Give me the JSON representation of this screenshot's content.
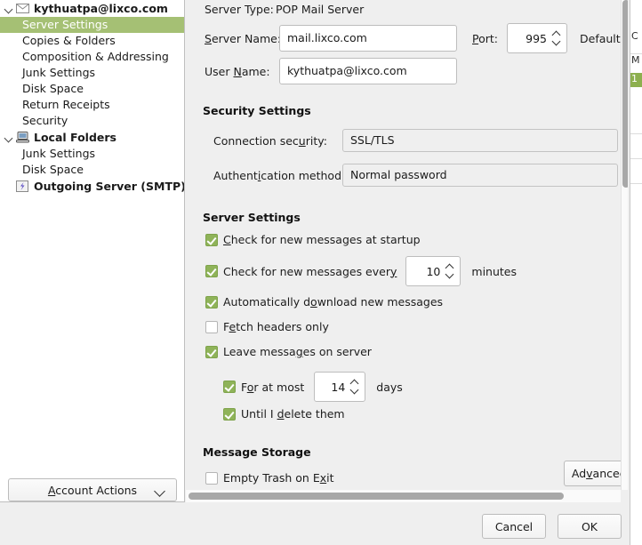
{
  "sidebar": {
    "account": {
      "label": "kythuatpa@lixco.com",
      "icon": "envelope-icon",
      "expanded": true,
      "items": [
        {
          "label": "Server Settings",
          "selected": true
        },
        {
          "label": "Copies & Folders",
          "selected": false
        },
        {
          "label": "Composition & Addressing",
          "selected": false
        },
        {
          "label": "Junk Settings",
          "selected": false
        },
        {
          "label": "Disk Space",
          "selected": false
        },
        {
          "label": "Return Receipts",
          "selected": false
        },
        {
          "label": "Security",
          "selected": false
        }
      ]
    },
    "local_folders": {
      "label": "Local Folders",
      "icon": "computer-icon",
      "expanded": true,
      "items": [
        {
          "label": "Junk Settings"
        },
        {
          "label": "Disk Space"
        }
      ]
    },
    "outgoing_server": {
      "label": "Outgoing Server (SMTP)",
      "icon": "smtp-icon"
    },
    "account_actions": {
      "label": "Account Actions",
      "accesskey": "A",
      "chevron": "chevron-down-icon"
    }
  },
  "pane": {
    "server_type": {
      "label": "Server Type:",
      "value": "POP Mail Server"
    },
    "server_name": {
      "label": "Server Name:",
      "accesskey": "S",
      "value": "mail.lixco.com"
    },
    "port": {
      "label": "Port:",
      "accesskey": "P",
      "value": "995"
    },
    "default_port": {
      "label": "Default:"
    },
    "user_name": {
      "label": "User Name:",
      "accesskey": "N",
      "value": "kythuatpa@lixco.com"
    },
    "security_settings": {
      "title": "Security Settings",
      "connection_security": {
        "label": "Connection security:",
        "accesskey": "u",
        "value": "SSL/TLS"
      },
      "authentication_method": {
        "label": "Authentication method:",
        "accesskey": "i",
        "value": "Normal password"
      }
    },
    "server_settings": {
      "title": "Server Settings",
      "check_at_startup": {
        "label": "Check for new messages at startup",
        "accesskey": "C",
        "checked": true
      },
      "check_every": {
        "label": "Check for new messages every",
        "accesskey": "y",
        "checked": true,
        "value": "10",
        "unit": "minutes"
      },
      "auto_download": {
        "label": "Automatically download new messages",
        "accesskey": "o",
        "checked": true
      },
      "fetch_headers_only": {
        "label": "Fetch headers only",
        "accesskey": "e",
        "checked": false
      },
      "leave_on_server": {
        "label": "Leave messages on server",
        "accesskey": "g",
        "checked": true
      },
      "for_at_most": {
        "label": "For at most",
        "accesskey": "o",
        "checked": true,
        "value": "14",
        "unit": "days"
      },
      "until_delete": {
        "label": "Until I delete them",
        "accesskey": "d",
        "checked": true
      }
    },
    "message_storage": {
      "title": "Message Storage",
      "empty_trash_on_exit": {
        "label": "Empty Trash on Exit",
        "accesskey": "x",
        "checked": false
      },
      "advanced_button": {
        "label": "Advanced…",
        "accesskey": "v"
      }
    }
  },
  "footer": {
    "cancel_label": "Cancel",
    "ok_label": "OK"
  },
  "colors": {
    "selection_green": "#a5c074",
    "checkbox_green": "#8fb359",
    "dialog_bg": "#efefef",
    "sidebar_bg": "#ffffff"
  },
  "background_window": {
    "rows": [
      "",
      "",
      "C",
      "M",
      "1",
      "",
      "",
      "",
      "",
      ""
    ]
  }
}
